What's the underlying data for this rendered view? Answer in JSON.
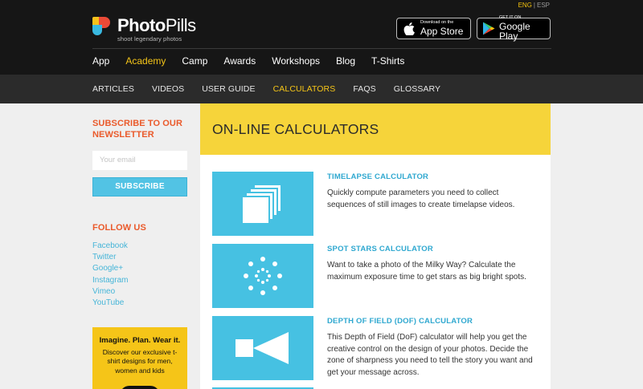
{
  "lang": {
    "active": "ENG",
    "separator": "|",
    "other": "ESP"
  },
  "brand": {
    "name_bold": "Photo",
    "name_light": "Pills",
    "tagline": "shoot legendary photos"
  },
  "stores": {
    "apple": {
      "small": "Download on the",
      "big": "App Store"
    },
    "google": {
      "small": "GET IT ON",
      "big": "Google Play"
    }
  },
  "main_nav": [
    {
      "label": "App"
    },
    {
      "label": "Academy",
      "active": true
    },
    {
      "label": "Camp"
    },
    {
      "label": "Awards"
    },
    {
      "label": "Workshops"
    },
    {
      "label": "Blog"
    },
    {
      "label": "T-Shirts"
    }
  ],
  "sub_nav": [
    {
      "label": "ARTICLES"
    },
    {
      "label": "VIDEOS"
    },
    {
      "label": "USER GUIDE"
    },
    {
      "label": "CALCULATORS",
      "active": true
    },
    {
      "label": "FAQS"
    },
    {
      "label": "GLOSSARY"
    }
  ],
  "sidebar": {
    "newsletter_title": "SUBSCRIBE TO OUR NEWSLETTER",
    "email_placeholder": "Your email",
    "subscribe_label": "SUBSCRIBE",
    "follow_title": "FOLLOW US",
    "social": [
      "Facebook",
      "Twitter",
      "Google+",
      "Instagram",
      "Vimeo",
      "YouTube"
    ]
  },
  "ad": {
    "headline": "Imagine. Plan. Wear it.",
    "text": "Discover our exclusive t-shirt designs for men, women and kids"
  },
  "page": {
    "title": "ON-LINE CALCULATORS",
    "calculators": [
      {
        "icon": "stacked-frames-icon",
        "title": "TIMELAPSE CALCULATOR",
        "desc": "Quickly compute parameters you need to collect sequences of still images to create timelapse videos."
      },
      {
        "icon": "star-burst-icon",
        "title": "SPOT STARS CALCULATOR",
        "desc": "Want to take a photo of the Milky Way? Calculate the maximum exposure time to get stars as big bright spots."
      },
      {
        "icon": "depth-of-field-icon",
        "title": "DEPTH OF FIELD (DOF) CALCULATOR",
        "desc": "This Depth of Field (DoF) calculator will help you get the creative control on the design of your photos. Decide the zone of sharpness you need to tell the story you want and get your message across."
      }
    ]
  },
  "colors": {
    "header_bg": "#161616",
    "subnav_bg": "#2b2b2b",
    "accent_yellow": "#f5c518",
    "banner_yellow": "#f6d43a",
    "accent_blue": "#46c1e2",
    "orange_heading": "#ea5a2b"
  }
}
